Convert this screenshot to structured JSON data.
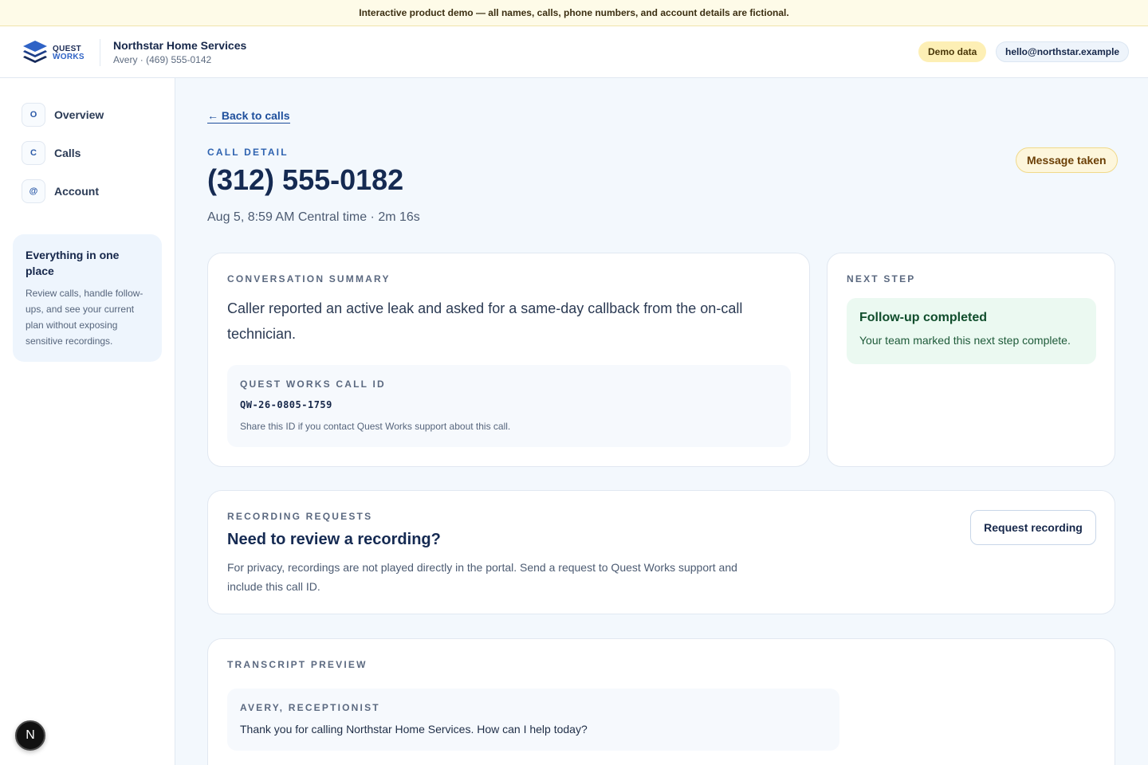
{
  "banner": {
    "text": "Interactive product demo — all names, calls, phone numbers, and account details are fictional."
  },
  "header": {
    "logo_line1": "QUEST",
    "logo_line2": "WORKS",
    "business_name": "Northstar Home Services",
    "business_sub": "Avery · (469) 555-0142",
    "demo_badge": "Demo data",
    "email": "hello@northstar.example"
  },
  "sidebar": {
    "items": [
      {
        "badge": "O",
        "label": "Overview"
      },
      {
        "badge": "C",
        "label": "Calls"
      },
      {
        "badge": "@",
        "label": "Account"
      }
    ],
    "card": {
      "title": "Everything in one place",
      "body": "Review calls, handle follow-ups, and see your current plan without exposing sensitive recordings."
    },
    "avatar_letter": "N"
  },
  "page": {
    "back_link": "← Back to calls",
    "eyebrow": "CALL DETAIL",
    "phone": "(312) 555-0182",
    "meta": "Aug 5, 8:59 AM Central time · 2m 16s",
    "status": "Message taken"
  },
  "summary": {
    "eyebrow": "CONVERSATION SUMMARY",
    "text": "Caller reported an active leak and asked for a same-day callback from the on-call technician.",
    "call_id_label": "QUEST WORKS CALL ID",
    "call_id": "QW-26-0805-1759",
    "call_id_note": "Share this ID if you contact Quest Works support about this call."
  },
  "next_step": {
    "eyebrow": "NEXT STEP",
    "title": "Follow-up completed",
    "body": "Your team marked this next step complete."
  },
  "recording": {
    "eyebrow": "RECORDING REQUESTS",
    "title": "Need to review a recording?",
    "body": "For privacy, recordings are not played directly in the portal. Send a request to Quest Works support and include this call ID.",
    "button": "Request recording"
  },
  "transcript": {
    "eyebrow": "TRANSCRIPT PREVIEW",
    "turns": [
      {
        "speaker": "AVERY, RECEPTIONIST",
        "text": "Thank you for calling Northstar Home Services. How can I help today?"
      }
    ]
  }
}
